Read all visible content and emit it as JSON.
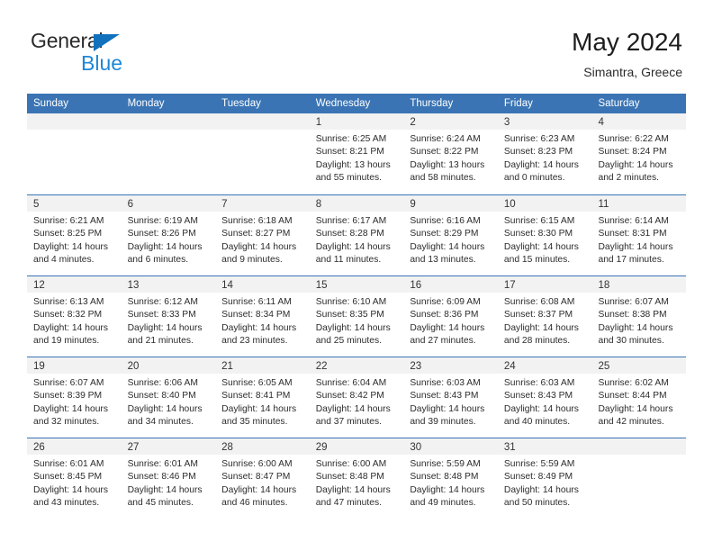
{
  "brand": {
    "word_one": "General",
    "word_two": "Blue",
    "triangle_color": "#1271bd",
    "blue_color": "#1e87d6"
  },
  "header": {
    "title": "May 2024",
    "subtitle": "Simantra, Greece"
  },
  "theme": {
    "header_row_color": "#3a74b4",
    "day_strip_color": "#f2f2f2",
    "text_color": "#2c2c2c"
  },
  "calendar": {
    "weekday_headers": [
      "Sunday",
      "Monday",
      "Tuesday",
      "Wednesday",
      "Thursday",
      "Friday",
      "Saturday"
    ],
    "weeks": [
      [
        {
          "day": "",
          "lines": []
        },
        {
          "day": "",
          "lines": []
        },
        {
          "day": "",
          "lines": []
        },
        {
          "day": "1",
          "lines": [
            "Sunrise: 6:25 AM",
            "Sunset: 8:21 PM",
            "Daylight: 13 hours",
            "and 55 minutes."
          ]
        },
        {
          "day": "2",
          "lines": [
            "Sunrise: 6:24 AM",
            "Sunset: 8:22 PM",
            "Daylight: 13 hours",
            "and 58 minutes."
          ]
        },
        {
          "day": "3",
          "lines": [
            "Sunrise: 6:23 AM",
            "Sunset: 8:23 PM",
            "Daylight: 14 hours",
            "and 0 minutes."
          ]
        },
        {
          "day": "4",
          "lines": [
            "Sunrise: 6:22 AM",
            "Sunset: 8:24 PM",
            "Daylight: 14 hours",
            "and 2 minutes."
          ]
        }
      ],
      [
        {
          "day": "5",
          "lines": [
            "Sunrise: 6:21 AM",
            "Sunset: 8:25 PM",
            "Daylight: 14 hours",
            "and 4 minutes."
          ]
        },
        {
          "day": "6",
          "lines": [
            "Sunrise: 6:19 AM",
            "Sunset: 8:26 PM",
            "Daylight: 14 hours",
            "and 6 minutes."
          ]
        },
        {
          "day": "7",
          "lines": [
            "Sunrise: 6:18 AM",
            "Sunset: 8:27 PM",
            "Daylight: 14 hours",
            "and 9 minutes."
          ]
        },
        {
          "day": "8",
          "lines": [
            "Sunrise: 6:17 AM",
            "Sunset: 8:28 PM",
            "Daylight: 14 hours",
            "and 11 minutes."
          ]
        },
        {
          "day": "9",
          "lines": [
            "Sunrise: 6:16 AM",
            "Sunset: 8:29 PM",
            "Daylight: 14 hours",
            "and 13 minutes."
          ]
        },
        {
          "day": "10",
          "lines": [
            "Sunrise: 6:15 AM",
            "Sunset: 8:30 PM",
            "Daylight: 14 hours",
            "and 15 minutes."
          ]
        },
        {
          "day": "11",
          "lines": [
            "Sunrise: 6:14 AM",
            "Sunset: 8:31 PM",
            "Daylight: 14 hours",
            "and 17 minutes."
          ]
        }
      ],
      [
        {
          "day": "12",
          "lines": [
            "Sunrise: 6:13 AM",
            "Sunset: 8:32 PM",
            "Daylight: 14 hours",
            "and 19 minutes."
          ]
        },
        {
          "day": "13",
          "lines": [
            "Sunrise: 6:12 AM",
            "Sunset: 8:33 PM",
            "Daylight: 14 hours",
            "and 21 minutes."
          ]
        },
        {
          "day": "14",
          "lines": [
            "Sunrise: 6:11 AM",
            "Sunset: 8:34 PM",
            "Daylight: 14 hours",
            "and 23 minutes."
          ]
        },
        {
          "day": "15",
          "lines": [
            "Sunrise: 6:10 AM",
            "Sunset: 8:35 PM",
            "Daylight: 14 hours",
            "and 25 minutes."
          ]
        },
        {
          "day": "16",
          "lines": [
            "Sunrise: 6:09 AM",
            "Sunset: 8:36 PM",
            "Daylight: 14 hours",
            "and 27 minutes."
          ]
        },
        {
          "day": "17",
          "lines": [
            "Sunrise: 6:08 AM",
            "Sunset: 8:37 PM",
            "Daylight: 14 hours",
            "and 28 minutes."
          ]
        },
        {
          "day": "18",
          "lines": [
            "Sunrise: 6:07 AM",
            "Sunset: 8:38 PM",
            "Daylight: 14 hours",
            "and 30 minutes."
          ]
        }
      ],
      [
        {
          "day": "19",
          "lines": [
            "Sunrise: 6:07 AM",
            "Sunset: 8:39 PM",
            "Daylight: 14 hours",
            "and 32 minutes."
          ]
        },
        {
          "day": "20",
          "lines": [
            "Sunrise: 6:06 AM",
            "Sunset: 8:40 PM",
            "Daylight: 14 hours",
            "and 34 minutes."
          ]
        },
        {
          "day": "21",
          "lines": [
            "Sunrise: 6:05 AM",
            "Sunset: 8:41 PM",
            "Daylight: 14 hours",
            "and 35 minutes."
          ]
        },
        {
          "day": "22",
          "lines": [
            "Sunrise: 6:04 AM",
            "Sunset: 8:42 PM",
            "Daylight: 14 hours",
            "and 37 minutes."
          ]
        },
        {
          "day": "23",
          "lines": [
            "Sunrise: 6:03 AM",
            "Sunset: 8:43 PM",
            "Daylight: 14 hours",
            "and 39 minutes."
          ]
        },
        {
          "day": "24",
          "lines": [
            "Sunrise: 6:03 AM",
            "Sunset: 8:43 PM",
            "Daylight: 14 hours",
            "and 40 minutes."
          ]
        },
        {
          "day": "25",
          "lines": [
            "Sunrise: 6:02 AM",
            "Sunset: 8:44 PM",
            "Daylight: 14 hours",
            "and 42 minutes."
          ]
        }
      ],
      [
        {
          "day": "26",
          "lines": [
            "Sunrise: 6:01 AM",
            "Sunset: 8:45 PM",
            "Daylight: 14 hours",
            "and 43 minutes."
          ]
        },
        {
          "day": "27",
          "lines": [
            "Sunrise: 6:01 AM",
            "Sunset: 8:46 PM",
            "Daylight: 14 hours",
            "and 45 minutes."
          ]
        },
        {
          "day": "28",
          "lines": [
            "Sunrise: 6:00 AM",
            "Sunset: 8:47 PM",
            "Daylight: 14 hours",
            "and 46 minutes."
          ]
        },
        {
          "day": "29",
          "lines": [
            "Sunrise: 6:00 AM",
            "Sunset: 8:48 PM",
            "Daylight: 14 hours",
            "and 47 minutes."
          ]
        },
        {
          "day": "30",
          "lines": [
            "Sunrise: 5:59 AM",
            "Sunset: 8:48 PM",
            "Daylight: 14 hours",
            "and 49 minutes."
          ]
        },
        {
          "day": "31",
          "lines": [
            "Sunrise: 5:59 AM",
            "Sunset: 8:49 PM",
            "Daylight: 14 hours",
            "and 50 minutes."
          ]
        },
        {
          "day": "",
          "lines": []
        }
      ]
    ]
  }
}
